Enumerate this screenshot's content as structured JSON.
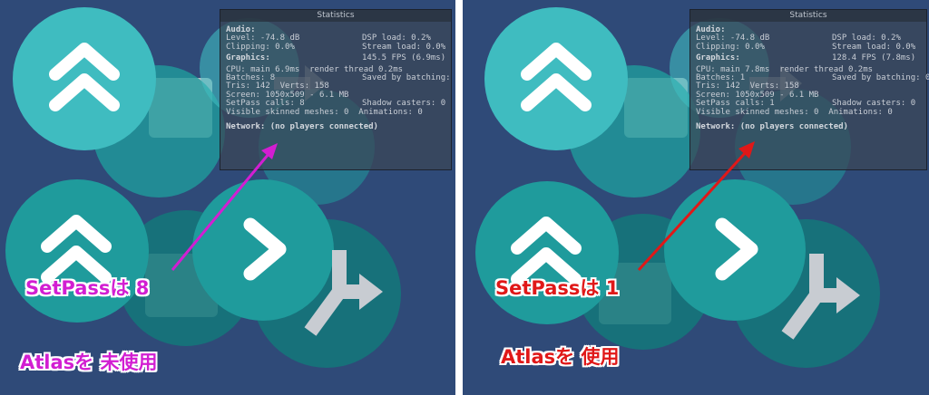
{
  "colors": {
    "panel_bg": "#2f4a78",
    "teal_light": "#3fbcc0",
    "teal_mid": "#1f9b9c",
    "teal_dark": "#13787a",
    "gray_square": "#c8ccd2",
    "left_accent": "#d21ed2",
    "right_accent": "#e01818"
  },
  "left_panel": {
    "stats": {
      "title": "Statistics",
      "audio_header": "Audio:",
      "level": "Level: -74.8 dB",
      "dsp_load": "DSP load: 0.2%",
      "clipping": "Clipping: 0.0%",
      "stream_load": "Stream load: 0.0%",
      "graphics_header": "Graphics:",
      "fps": "145.5 FPS (6.9ms)",
      "cpu": "CPU: main 6.9ms  render thread 0.2ms",
      "batches": "Batches: 8",
      "saved_batching": "Saved by batching: 0",
      "tris": "Tris: 142  Verts: 158",
      "screen": "Screen: 1050x509 - 6.1 MB",
      "setpass_calls": "SetPass calls: 8",
      "shadow_casters": "Shadow casters: 0",
      "skinned": "Visible skinned meshes: 0  Animations: 0",
      "network": "Network: (no players connected)"
    },
    "caption_setpass": "SetPassは 8",
    "caption_atlas": "Atlasを 未使用"
  },
  "right_panel": {
    "stats": {
      "title": "Statistics",
      "audio_header": "Audio:",
      "level": "Level: -74.8 dB",
      "dsp_load": "DSP load: 0.2%",
      "clipping": "Clipping: 0.0%",
      "stream_load": "Stream load: 0.0%",
      "graphics_header": "Graphics:",
      "fps": "128.4 FPS (7.8ms)",
      "cpu": "CPU: main 7.8ms  render thread 0.2ms",
      "batches": "Batches: 1",
      "saved_batching": "Saved by batching: 0",
      "tris": "Tris: 142  Verts: 158",
      "screen": "Screen: 1050x509 - 6.1 MB",
      "setpass_calls": "SetPass calls: 1",
      "shadow_casters": "Shadow casters: 0",
      "skinned": "Visible skinned meshes: 0  Animations: 0",
      "network": "Network: (no players connected)"
    },
    "caption_setpass": "SetPassは 1",
    "caption_atlas": "Atlasを 使用"
  },
  "icons": [
    "double-chevron-up-icon",
    "chevron-right-icon",
    "split-arrows-icon",
    "arrow-right-icon"
  ]
}
